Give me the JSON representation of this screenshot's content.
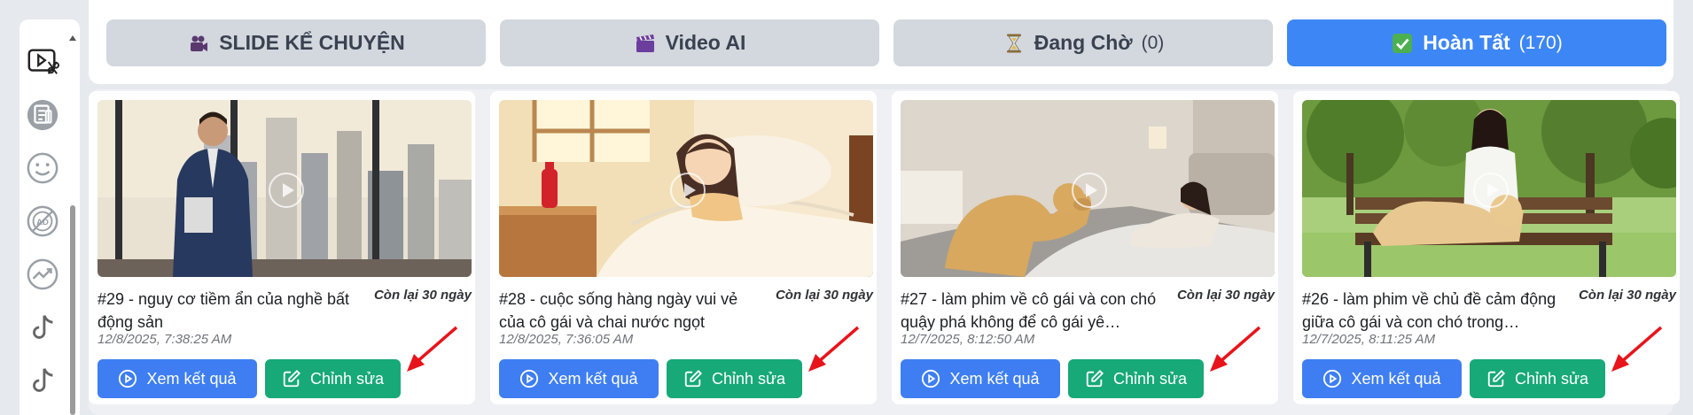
{
  "sidebar": {
    "icons": [
      "video-edit-icon",
      "document-icon",
      "smiley-icon",
      "ad-icon",
      "trending-icon",
      "tiktok-icon",
      "tiktok-icon"
    ]
  },
  "tabs": [
    {
      "label": "SLIDE KỂ CHUYỆN",
      "count": "",
      "icon": "camera-icon",
      "active": false
    },
    {
      "label": "Video AI",
      "count": "",
      "icon": "clapperboard-icon",
      "active": false
    },
    {
      "label": "Đang Chờ",
      "count": "(0)",
      "icon": "hourglass-icon",
      "active": false
    },
    {
      "label": "Hoàn Tất",
      "count": "(170)",
      "icon": "check-icon",
      "active": true
    }
  ],
  "cards": [
    {
      "title": "#29 - nguy cơ tiềm ẩn của nghề bất động sản",
      "remaining": "Còn lại 30 ngày",
      "date": "12/8/2025, 7:38:25 AM",
      "view_label": "Xem kết quả",
      "edit_label": "Chỉnh sửa"
    },
    {
      "title": "#28 - cuộc sống hàng ngày vui vẻ của cô gái và chai nước ngọt",
      "remaining": "Còn lại 30 ngày",
      "date": "12/8/2025, 7:36:05 AM",
      "view_label": "Xem kết quả",
      "edit_label": "Chỉnh sửa"
    },
    {
      "title": "#27 - làm phim về cô gái và con chó quậy phá không để cô gái yê…",
      "remaining": "Còn lại 30 ngày",
      "date": "12/7/2025, 8:12:50 AM",
      "view_label": "Xem kết quả",
      "edit_label": "Chỉnh sửa"
    },
    {
      "title": "#26 - làm phim về chủ đề cảm động giữa cô gái và con chó trong…",
      "remaining": "Còn lại 30 ngày",
      "date": "12/7/2025, 8:11:25 AM",
      "view_label": "Xem kết quả",
      "edit_label": "Chỉnh sửa"
    }
  ],
  "colors": {
    "primary": "#3d86f5",
    "success": "#17a977",
    "annotation_arrow": "#e8141b"
  }
}
